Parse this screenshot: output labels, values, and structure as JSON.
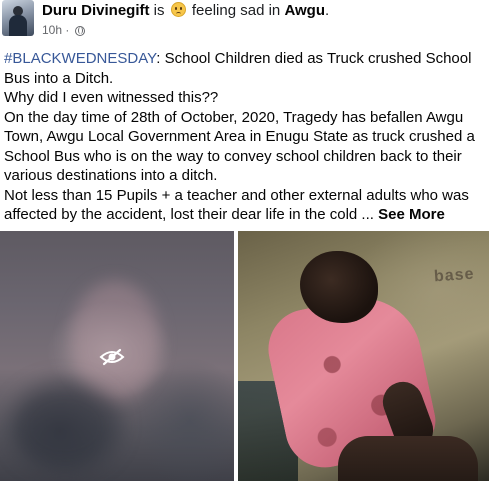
{
  "post": {
    "author": "Duru Divinegift",
    "activity_prefix": "is",
    "feeling_text": "feeling sad in",
    "location": "Awgu",
    "location_suffix": ".",
    "time": "10h",
    "separator": "·",
    "feeling_icon": "sad-face-emoji-icon",
    "audience_icon": "globe-icon"
  },
  "body": {
    "hashtag": "#BLACKWEDNESDAY",
    "line1_rest": ": School Children died as Truck crushed School",
    "line2": "Bus into a Ditch.",
    "line3": "Why did I even witnessed this??",
    "line4": "On the day time of 28th of October, 2020, Tragedy has befallen Awgu",
    "line5": "Town, Awgu Local Government Area in Enugu State as truck crushed a",
    "line6": "School Bus who is on the way to convey school children back to their",
    "line7": "various destinations into a ditch.",
    "line8": "Not less than 15 Pupils + a teacher and other external adults who was",
    "line9": "affected by the accident, lost their dear life in the cold ...",
    "see_more": "See More"
  },
  "photos": {
    "left_icon": "hidden-eye-icon",
    "right_bg_text": "base"
  },
  "colors": {
    "link": "#385898",
    "meta": "#65676b",
    "text": "#050505"
  }
}
